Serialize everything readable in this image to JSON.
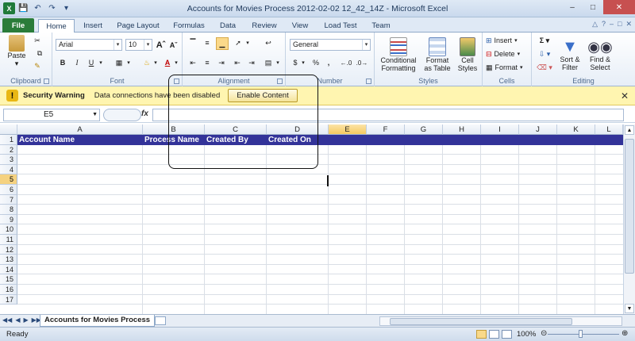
{
  "window": {
    "title": "Accounts for Movies Process 2012-02-02 12_42_14Z  -  Microsoft Excel"
  },
  "tabs": [
    {
      "label": "File"
    },
    {
      "label": "Home"
    },
    {
      "label": "Insert"
    },
    {
      "label": "Page Layout"
    },
    {
      "label": "Formulas"
    },
    {
      "label": "Data"
    },
    {
      "label": "Review"
    },
    {
      "label": "View"
    },
    {
      "label": "Load Test"
    },
    {
      "label": "Team"
    }
  ],
  "ribbon": {
    "clipboard": {
      "label": "Clipboard",
      "paste": "Paste"
    },
    "font": {
      "label": "Font",
      "family": "Arial",
      "size": "10",
      "bold": "B",
      "italic": "I",
      "underline": "U"
    },
    "alignment": {
      "label": "Alignment"
    },
    "number": {
      "label": "Number",
      "format": "General",
      "currency": "$",
      "percent": "%",
      "comma": ","
    },
    "styles": {
      "label": "Styles",
      "conditional1": "Conditional",
      "conditional2": "Formatting",
      "format_table1": "Format",
      "format_table2": "as Table",
      "cell_styles1": "Cell",
      "cell_styles2": "Styles"
    },
    "cells": {
      "label": "Cells",
      "insert": "Insert",
      "delete": "Delete",
      "format": "Format"
    },
    "editing": {
      "label": "Editing",
      "sort1": "Sort &",
      "sort2": "Filter",
      "find1": "Find &",
      "find2": "Select"
    }
  },
  "security": {
    "title": "Security Warning",
    "message": "Data connections have been disabled",
    "button": "Enable Content"
  },
  "formula_bar": {
    "name_box": "E5",
    "fx": "fx",
    "value": ""
  },
  "columns": [
    "A",
    "B",
    "C",
    "D",
    "E",
    "F",
    "G",
    "H",
    "I",
    "J",
    "K",
    "L"
  ],
  "rows": [
    "1",
    "2",
    "3",
    "4",
    "5",
    "6",
    "7",
    "8",
    "9",
    "10",
    "11",
    "12",
    "13",
    "14",
    "15",
    "16",
    "17"
  ],
  "header_cells": [
    "Account Name",
    "Process Name",
    "Created By",
    "Created On"
  ],
  "sheet_tab": "Accounts for Movies Process",
  "status": {
    "ready": "Ready",
    "zoom": "100%"
  }
}
